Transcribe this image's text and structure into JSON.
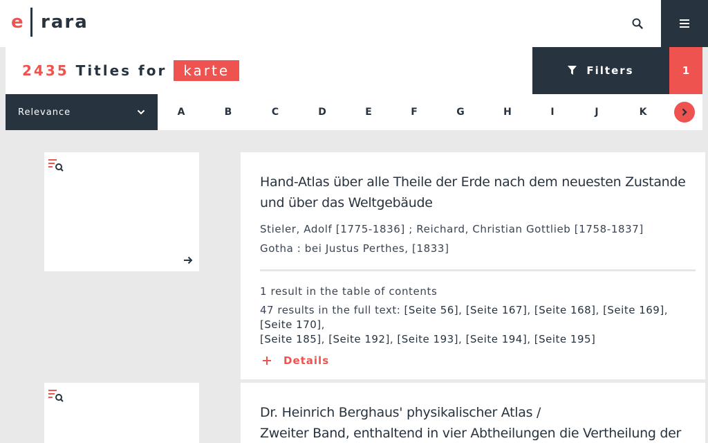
{
  "header": {
    "logo_letter": "e",
    "logo_text": "rara",
    "search_icon": "search-icon",
    "menu_icon": "hamburger-menu-icon"
  },
  "colors": {
    "accent": "#ef5350",
    "dark": "#27333f",
    "background": "#e9e9e9"
  },
  "search": {
    "count": "2435",
    "titles_for": "Titles for",
    "query": "karte",
    "filters_label": "Filters",
    "filter_count": "1"
  },
  "sort": {
    "selected": "Relevance"
  },
  "alphabet": {
    "letters": [
      "A",
      "B",
      "C",
      "D",
      "E",
      "F",
      "G",
      "H",
      "I",
      "J",
      "K"
    ]
  },
  "results": [
    {
      "title_line1": "Hand-Atlas über alle Theile der Erde nach dem neuesten Zustande",
      "title_line2": "und über das Weltgebäude",
      "authors": "Stieler, Adolf [1775-1836] ; Reichard, Christian Gottlieb [1758-1837]",
      "publisher": "Gotha : bei Justus Perthes, [1833]",
      "toc_text": "1 result in the table of contents",
      "fulltext_prefix": "47 results in the full text:",
      "pages": [
        "[Seite 56]",
        "[Seite 167]",
        "[Seite 168]",
        "[Seite 169]",
        "[Seite 170]",
        "[Seite 185]",
        "[Seite 192]",
        "[Seite 193]",
        "[Seite 194]",
        "[Seite 195]"
      ],
      "details_label": "Details"
    },
    {
      "title_line1": "Dr. Heinrich Berghaus' physikalischer Atlas /",
      "title_line2": "Zweiter Band, enthaltend in vier Abtheilungen die Vertheilung der"
    }
  ]
}
